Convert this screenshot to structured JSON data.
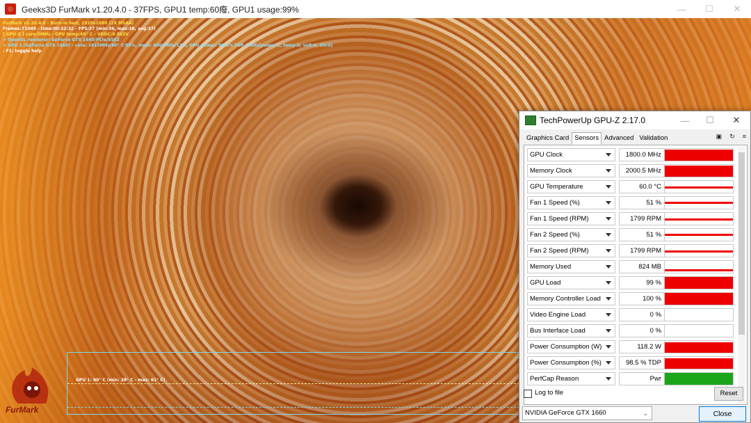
{
  "furmark": {
    "title": "Geeks3D FurMark v1.20.4.0 - 37FPS, GPU1 temp:60癈, GPU1 usage:99%",
    "overlay": [
      {
        "text": "FurMark v1.20.4.0 - Burn-in test, 1920x1080 (2X MSAA)",
        "style": "y"
      },
      {
        "text": "Frames:71049 - time:00:32:32 - FPS:37 (min:36, max:38, avg:37)",
        "style": "w"
      },
      {
        "text": "[ GPU-Z ] core:0MHz - GPU temp:60° C - VDDC:0.962V",
        "style": "y"
      },
      {
        "text": "> OpenGL renderer: GeForce GTX 1660/PCIe/SSE2",
        "style": "c"
      },
      {
        "text": "> GPU 1 (GeForce GTX 1660) - core: 1815MHz/60° C/99%, mem: 4001MHz/13%, GPU power: 98.9% TDP, limits[power:1, temp:0, volt:0, OV:0]",
        "style": "c"
      },
      {
        "text": "- F1: toggle help",
        "style": "w"
      }
    ],
    "temp_graph_label": "GPU 1: 60° C (min: 38° C - max: 61° C)",
    "logo_text": "FurMark"
  },
  "gpuz": {
    "title": "TechPowerUp GPU-Z 2.17.0",
    "tabs": [
      "Graphics Card",
      "Sensors",
      "Advanced",
      "Validation"
    ],
    "active_tab": "Sensors",
    "sensors": [
      {
        "name": "GPU Clock",
        "value": "1800.0 MHz",
        "level": 0.95,
        "color": "#ee0000",
        "style": "full"
      },
      {
        "name": "Memory Clock",
        "value": "2000.5 MHz",
        "level": 0.95,
        "color": "#ee0000",
        "style": "full"
      },
      {
        "name": "GPU Temperature",
        "value": "60.0 °C",
        "level": 0.45,
        "color": "#ee0000",
        "style": "line"
      },
      {
        "name": "Fan 1 Speed (%)",
        "value": "51 %",
        "level": 0.5,
        "color": "#ee0000",
        "style": "line"
      },
      {
        "name": "Fan 1 Speed (RPM)",
        "value": "1799 RPM",
        "level": 0.4,
        "color": "#ee0000",
        "style": "line"
      },
      {
        "name": "Fan 2 Speed (%)",
        "value": "51 %",
        "level": 0.5,
        "color": "#ee0000",
        "style": "line"
      },
      {
        "name": "Fan 2 Speed (RPM)",
        "value": "1799 RPM",
        "level": 0.4,
        "color": "#ee0000",
        "style": "line"
      },
      {
        "name": "Memory Used",
        "value": "824 MB",
        "level": 0.15,
        "color": "#ee0000",
        "style": "line"
      },
      {
        "name": "GPU Load",
        "value": "99 %",
        "level": 0.99,
        "color": "#ee0000",
        "style": "full"
      },
      {
        "name": "Memory Controller Load",
        "value": "100 %",
        "level": 1.0,
        "color": "#ee0000",
        "style": "full"
      },
      {
        "name": "Video Engine Load",
        "value": "0 %",
        "level": 0,
        "color": "#ee0000",
        "style": "full"
      },
      {
        "name": "Bus Interface Load",
        "value": "0 %",
        "level": 0,
        "color": "#ee0000",
        "style": "full"
      },
      {
        "name": "Power Consumption (W)",
        "value": "118.2 W",
        "level": 0.9,
        "color": "#ee0000",
        "style": "full"
      },
      {
        "name": "Power Consumption (%)",
        "value": "98.5 % TDP",
        "level": 0.9,
        "color": "#ee0000",
        "style": "full"
      },
      {
        "name": "PerfCap Reason",
        "value": "Pwr",
        "level": 1.0,
        "color": "#1aa51a",
        "style": "full"
      }
    ],
    "log_to_file": "Log to file",
    "reset": "Reset",
    "device": "NVIDIA GeForce GTX 1660",
    "close": "Close"
  }
}
